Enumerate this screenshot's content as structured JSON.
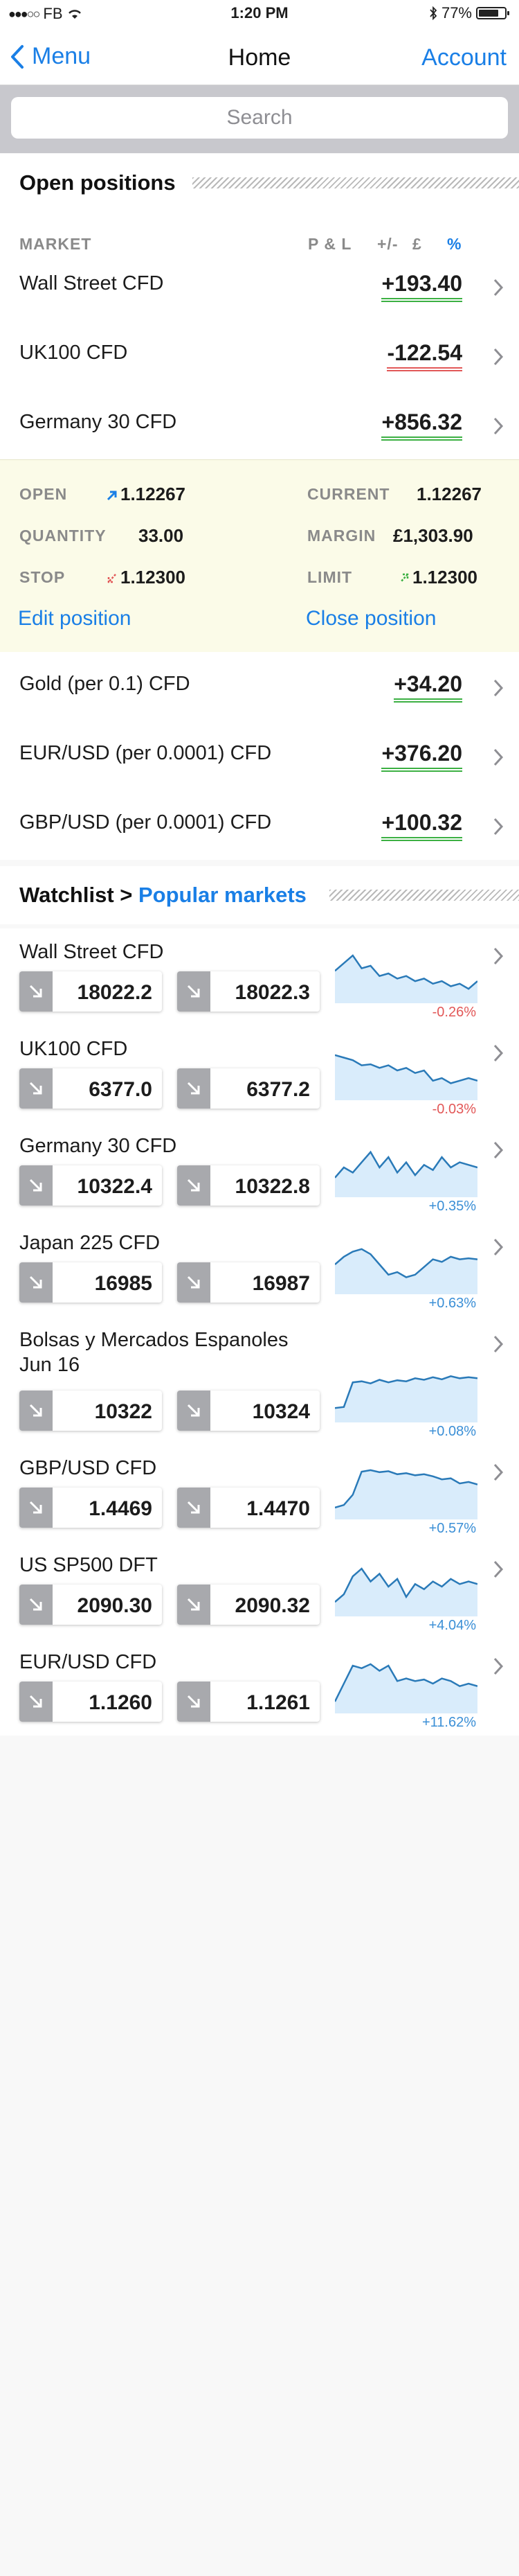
{
  "status_bar": {
    "carrier": "FB",
    "time": "1:20 PM",
    "battery": "77%"
  },
  "nav": {
    "back_label": "Menu",
    "title": "Home",
    "right_label": "Account"
  },
  "search": {
    "placeholder": "Search"
  },
  "open_positions": {
    "title": "Open positions",
    "columns": {
      "market": "MARKET",
      "pl": "P & L",
      "plusminus": "+/-",
      "pound": "£",
      "percent": "%"
    },
    "rows_top": [
      {
        "name": "Wall Street CFD",
        "value": "+193.40",
        "sign": "pos"
      },
      {
        "name": "UK100 CFD",
        "value": "-122.54",
        "sign": "neg"
      },
      {
        "name": "Germany 30 CFD",
        "value": "+856.32",
        "sign": "pos"
      }
    ],
    "detail": {
      "open_label": "OPEN",
      "open_value": "1.12267",
      "current_label": "CURRENT",
      "current_value": "1.12267",
      "quantity_label": "QUANTITY",
      "quantity_value": "33.00",
      "margin_label": "MARGIN",
      "margin_value": "£1,303.90",
      "stop_label": "STOP",
      "stop_value": "1.12300",
      "limit_label": "LIMIT",
      "limit_value": "1.12300",
      "edit_label": "Edit position",
      "close_label": "Close position"
    },
    "rows_bottom": [
      {
        "name": "Gold (per 0.1) CFD",
        "value": "+34.20",
        "sign": "pos"
      },
      {
        "name": "EUR/USD (per 0.0001) CFD",
        "value": "+376.20",
        "sign": "pos"
      },
      {
        "name": "GBP/USD (per 0.0001) CFD",
        "value": "+100.32",
        "sign": "pos"
      }
    ]
  },
  "watchlist": {
    "title": "Watchlist >",
    "link": "Popular markets",
    "items": [
      {
        "name": "Wall Street CFD",
        "sell": "18022.2",
        "buy": "18022.3",
        "change": "-0.26%",
        "sign": "neg"
      },
      {
        "name": "UK100 CFD",
        "sell": "6377.0",
        "buy": "6377.2",
        "change": "-0.03%",
        "sign": "neg"
      },
      {
        "name": "Germany 30 CFD",
        "sell": "10322.4",
        "buy": "10322.8",
        "change": "+0.35%",
        "sign": "pos"
      },
      {
        "name": "Japan 225 CFD",
        "sell": "16985",
        "buy": "16987",
        "change": "+0.63%",
        "sign": "pos"
      },
      {
        "name": "Bolsas y Mercados Espanoles Jun 16",
        "sell": "10322",
        "buy": "10324",
        "change": "+0.08%",
        "sign": "pos"
      },
      {
        "name": "GBP/USD CFD",
        "sell": "1.4469",
        "buy": "1.4470",
        "change": "+0.57%",
        "sign": "pos"
      },
      {
        "name": "US SP500 DFT",
        "sell": "2090.30",
        "buy": "2090.32",
        "change": "+4.04%",
        "sign": "pos"
      },
      {
        "name": "EUR/USD CFD",
        "sell": "1.1260",
        "buy": "1.1261",
        "change": "+11.62%",
        "sign": "pos"
      }
    ]
  },
  "colors": {
    "accent": "#1a7fe6",
    "positive": "#3cb043",
    "negative": "#e25858",
    "spark_fill": "#d9ecfb",
    "spark_line": "#2a7ab8"
  }
}
